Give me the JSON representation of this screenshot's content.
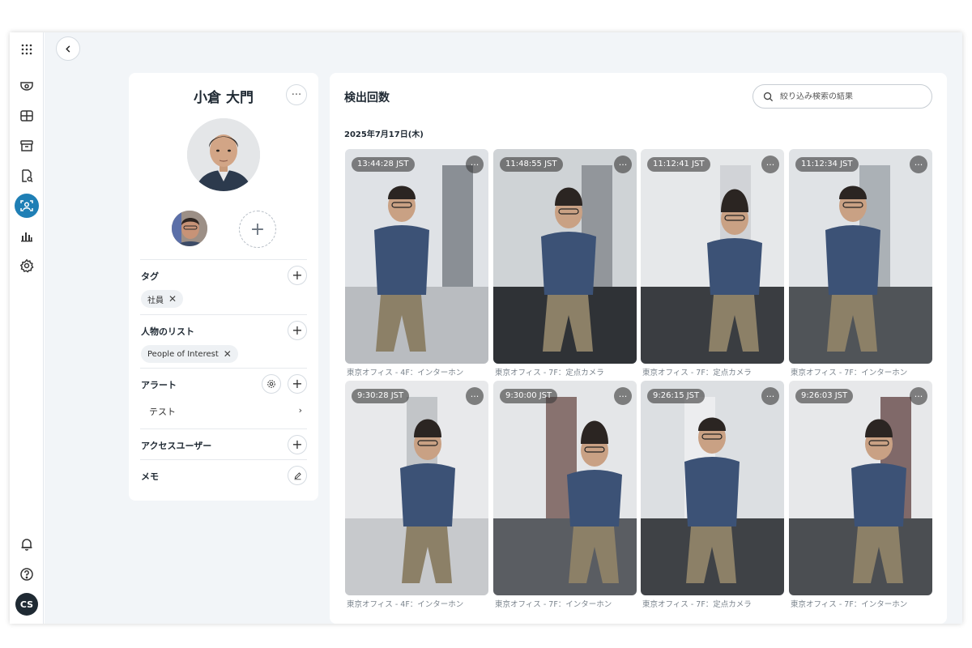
{
  "nav": {
    "items": [
      {
        "icon": "apps-grid-icon",
        "active": false
      },
      {
        "icon": "camera-dome-icon",
        "active": false
      },
      {
        "icon": "video-wall-icon",
        "active": false
      },
      {
        "icon": "archive-icon",
        "active": false
      },
      {
        "icon": "report-search-icon",
        "active": false
      },
      {
        "icon": "face-recognition-icon",
        "active": true
      },
      {
        "icon": "analytics-chart-icon",
        "active": false
      },
      {
        "icon": "settings-gear-icon",
        "active": false
      }
    ],
    "user_initials": "CS",
    "accent": "#1f7fb5"
  },
  "profile": {
    "name": "小倉 大門",
    "more_label": "···",
    "add_photo_label": "+",
    "tags": {
      "title": "タグ",
      "items": [
        "社員"
      ]
    },
    "person_lists": {
      "title": "人物のリスト",
      "items": [
        "People of Interest"
      ]
    },
    "alerts": {
      "title": "アラート",
      "items": [
        "テスト"
      ]
    },
    "access_users": {
      "title": "アクセスユーザー"
    },
    "memo": {
      "title": "メモ"
    }
  },
  "detections": {
    "title": "検出回数",
    "search_placeholder": "絞り込み検索の結果",
    "date": "2025年7月17日(木)",
    "cards": [
      {
        "time": "13:44:28 JST",
        "location": "東京オフィス - 4F：インターホン"
      },
      {
        "time": "11:48:55 JST",
        "location": "東京オフィス - 7F：定点カメラ"
      },
      {
        "time": "11:12:41 JST",
        "location": "東京オフィス - 7F：定点カメラ"
      },
      {
        "time": "11:12:34 JST",
        "location": "東京オフィス - 7F：インターホン"
      },
      {
        "time": "9:30:28 JST",
        "location": "東京オフィス - 4F：インターホン"
      },
      {
        "time": "9:30:00 JST",
        "location": "東京オフィス - 7F：インターホン"
      },
      {
        "time": "9:26:15 JST",
        "location": "東京オフィス - 7F：定点カメラ"
      },
      {
        "time": "9:26:03 JST",
        "location": "東京オフィス - 7F：インターホン"
      }
    ]
  }
}
